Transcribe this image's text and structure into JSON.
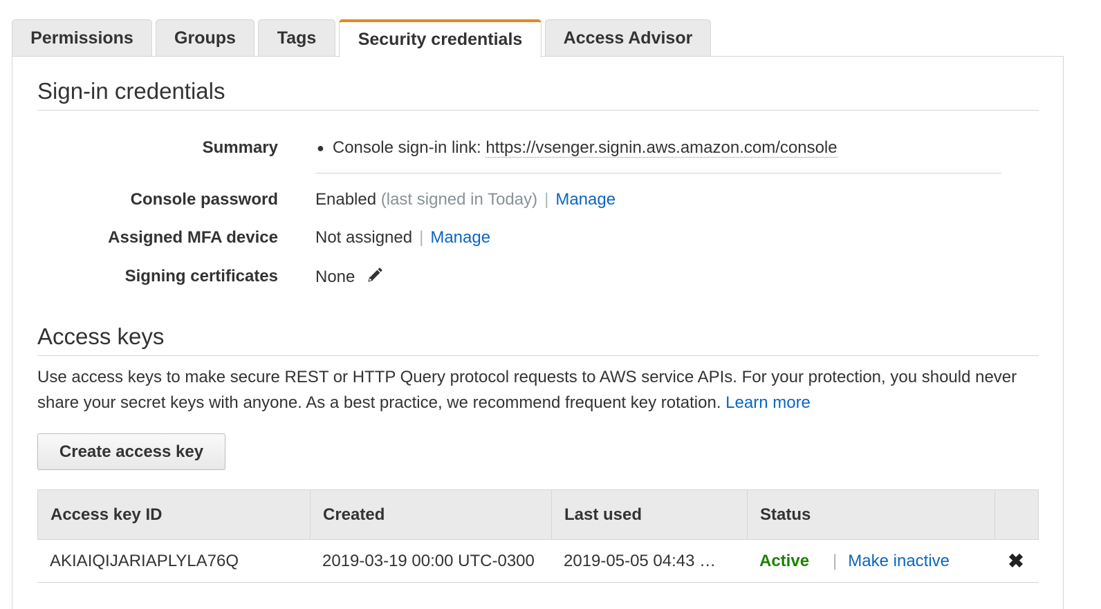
{
  "tabs": [
    {
      "label": "Permissions",
      "active": false
    },
    {
      "label": "Groups",
      "active": false
    },
    {
      "label": "Tags",
      "active": false
    },
    {
      "label": "Security credentials",
      "active": true
    },
    {
      "label": "Access Advisor",
      "active": false
    }
  ],
  "colors": {
    "active_tab_border": "#e7861f",
    "link": "#0a66c2",
    "status_active": "#1d8102"
  },
  "signin": {
    "title": "Sign-in credentials",
    "summary_label": "Summary",
    "summary_prefix": "Console sign-in link:",
    "summary_url": "https://vsenger.signin.aws.amazon.com/console",
    "password_label": "Console password",
    "password_status": "Enabled",
    "password_note": "(last signed in Today)",
    "password_manage": "Manage",
    "mfa_label": "Assigned MFA device",
    "mfa_status": "Not assigned",
    "mfa_manage": "Manage",
    "certs_label": "Signing certificates",
    "certs_value": "None",
    "certs_icon": "pencil-icon"
  },
  "access_keys": {
    "title": "Access keys",
    "description": "Use access keys to make secure REST or HTTP Query protocol requests to AWS service APIs. For your protection, you should never share your secret keys with anyone. As a best practice, we recommend frequent key rotation.",
    "learn_more": "Learn more",
    "create_button": "Create access key",
    "columns": [
      "Access key ID",
      "Created",
      "Last used",
      "Status"
    ],
    "rows": [
      {
        "id": "AKIAIQIJARIAPLYLA76Q",
        "created": "2019-03-19 00:00 UTC-0300",
        "last_used": "2019-05-05 04:43 …",
        "status": "Active",
        "action": "Make inactive",
        "delete_icon": "close-icon"
      }
    ]
  }
}
